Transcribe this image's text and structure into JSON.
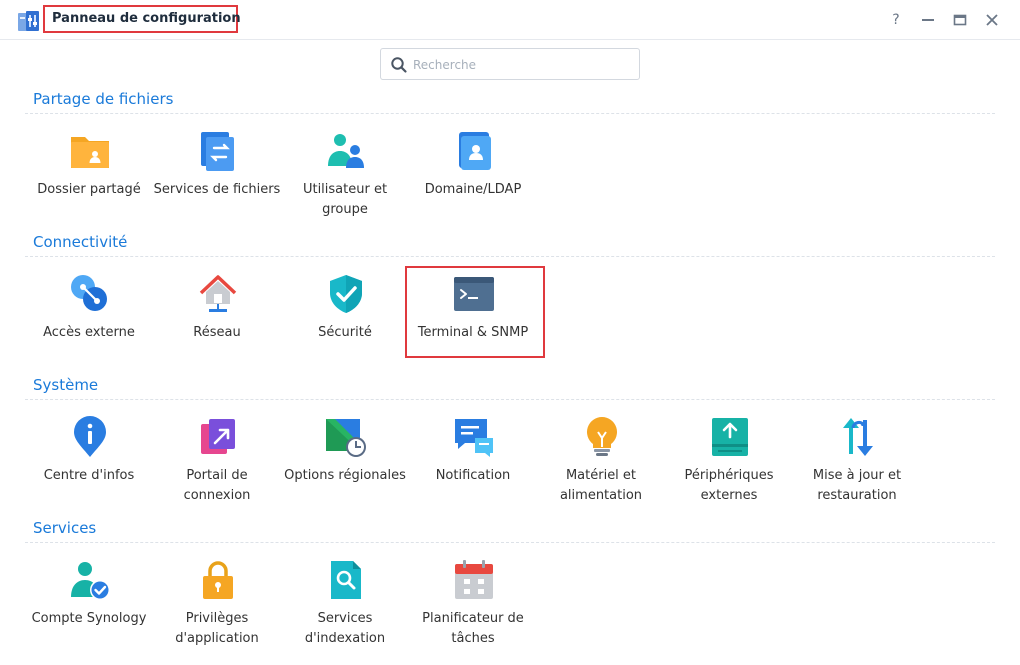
{
  "window": {
    "title": "Panneau de configuration",
    "controls": {
      "help": "?",
      "minimize": "—",
      "maximize": "□",
      "close": "✕"
    }
  },
  "search": {
    "placeholder": "Recherche",
    "value": ""
  },
  "sections": [
    {
      "title": "Partage de fichiers",
      "items": [
        {
          "label": "Dossier partagé",
          "icon": "shared-folder-icon"
        },
        {
          "label": "Services de fichiers",
          "icon": "file-services-icon"
        },
        {
          "label": "Utilisateur et groupe",
          "icon": "user-group-icon"
        },
        {
          "label": "Domaine/LDAP",
          "icon": "domain-ldap-icon"
        }
      ]
    },
    {
      "title": "Connectivité",
      "items": [
        {
          "label": "Accès externe",
          "icon": "external-access-icon"
        },
        {
          "label": "Réseau",
          "icon": "network-icon"
        },
        {
          "label": "Sécurité",
          "icon": "security-shield-icon"
        },
        {
          "label": "Terminal & SNMP",
          "icon": "terminal-icon",
          "highlighted": true
        }
      ]
    },
    {
      "title": "Système",
      "items": [
        {
          "label": "Centre d'infos",
          "icon": "info-center-icon"
        },
        {
          "label": "Portail de connexion",
          "icon": "login-portal-icon"
        },
        {
          "label": "Options régionales",
          "icon": "regional-options-icon"
        },
        {
          "label": "Notification",
          "icon": "notification-icon"
        },
        {
          "label": "Matériel et alimentation",
          "icon": "hardware-power-icon"
        },
        {
          "label": "Périphériques externes",
          "icon": "external-devices-icon"
        },
        {
          "label": "Mise à jour et restauration",
          "icon": "update-restore-icon"
        }
      ]
    },
    {
      "title": "Services",
      "items": [
        {
          "label": "Compte Synology",
          "icon": "synology-account-icon"
        },
        {
          "label": "Privilèges d'application",
          "icon": "app-privileges-icon"
        },
        {
          "label": "Services d'indexation",
          "icon": "indexing-service-icon"
        },
        {
          "label": "Planificateur de tâches",
          "icon": "task-scheduler-icon"
        }
      ]
    }
  ],
  "colors": {
    "accent": "#1a7ad9",
    "highlight_border": "#e0393e"
  }
}
